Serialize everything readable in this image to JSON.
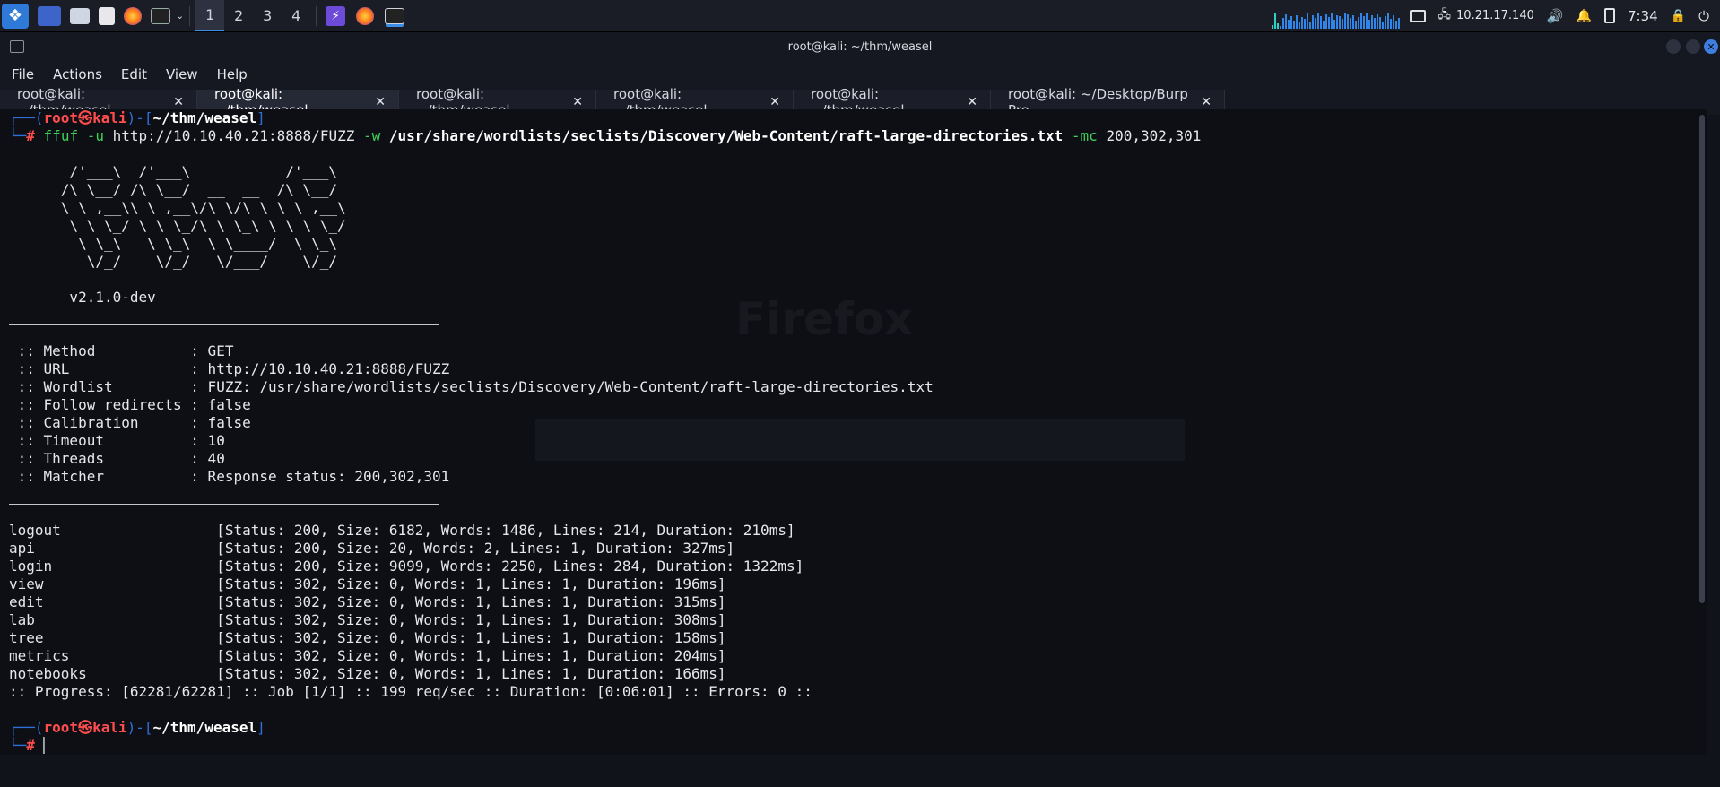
{
  "panel": {
    "workspaces": [
      "1",
      "2",
      "3",
      "4"
    ],
    "ip": "10.21.17.140",
    "clock": "7:34",
    "icons": [
      "kali-menu-icon",
      "desktop-icon",
      "files-icon",
      "text-editor-icon",
      "firefox-icon",
      "terminal-icon",
      "chevron-down-icon",
      "burp-icon",
      "firefox-icon",
      "terminal-icon",
      "display-icon",
      "network-icon",
      "volume-icon",
      "bell-icon",
      "battery-icon",
      "lock-icon",
      "power-icon"
    ],
    "accent": "#3a8ee6"
  },
  "window": {
    "title": "root@kali: ~/thm/weasel",
    "menu": [
      "File",
      "Actions",
      "Edit",
      "View",
      "Help"
    ],
    "tabs": [
      {
        "label": "root@kali: ~/thm/weasel",
        "active": false
      },
      {
        "label": "root@kali: ~/thm/weasel",
        "active": true
      },
      {
        "label": "root@kali: ~/thm/weasel",
        "active": false
      },
      {
        "label": "root@kali: ~/thm/weasel",
        "active": false
      },
      {
        "label": "root@kali: ~/thm/weasel",
        "active": false
      },
      {
        "label": "root@kali: ~/Desktop/Burp Pro",
        "active": false
      }
    ],
    "close_glyph": "✕"
  },
  "terminal": {
    "prompt1": {
      "frame_a": "┌──(",
      "user": "root",
      "skull": "㉿",
      "host": "kali",
      "frame_b": ")-[",
      "path": "~/thm/weasel",
      "frame_c": "]"
    },
    "cmd": {
      "frame": "└─",
      "hash": "#",
      "bin": "ffuf",
      "f1": "-u",
      "url": "http://10.10.40.21:8888/FUZZ",
      "f2": "-w",
      "wordlist": "/usr/share/wordlists/seclists/Discovery/Web-Content/raft-large-directories.txt",
      "f3": "-mc",
      "codes": "200,302,301"
    },
    "banner": [
      "       /'___\\  /'___\\           /'___\\       ",
      "      /\\ \\__/ /\\ \\__/  __  __  /\\ \\__/       ",
      "      \\ \\ ,__\\\\ \\ ,__\\/\\ \\/\\ \\ \\ \\ ,__\\      ",
      "       \\ \\ \\_/ \\ \\ \\_/\\ \\ \\_\\ \\ \\ \\ \\_/      ",
      "        \\ \\_\\   \\ \\_\\  \\ \\____/  \\ \\_\\       ",
      "         \\/_/    \\/_/   \\/___/    \\/_/       "
    ],
    "version": "       v2.1.0-dev",
    "config": [
      " :: Method           : GET",
      " :: URL              : http://10.10.40.21:8888/FUZZ",
      " :: Wordlist         : FUZZ: /usr/share/wordlists/seclists/Discovery/Web-Content/raft-large-directories.txt",
      " :: Follow redirects : false",
      " :: Calibration      : false",
      " :: Timeout          : 10",
      " :: Threads          : 40",
      " :: Matcher          : Response status: 200,302,301"
    ],
    "results": [
      "logout                  [Status: 200, Size: 6182, Words: 1486, Lines: 214, Duration: 210ms]",
      "api                     [Status: 200, Size: 20, Words: 2, Lines: 1, Duration: 327ms]",
      "login                   [Status: 200, Size: 9099, Words: 2250, Lines: 284, Duration: 1322ms]",
      "view                    [Status: 302, Size: 0, Words: 1, Lines: 1, Duration: 196ms]",
      "edit                    [Status: 302, Size: 0, Words: 1, Lines: 1, Duration: 315ms]",
      "lab                     [Status: 302, Size: 0, Words: 1, Lines: 1, Duration: 308ms]",
      "tree                    [Status: 302, Size: 0, Words: 1, Lines: 1, Duration: 158ms]",
      "metrics                 [Status: 302, Size: 0, Words: 1, Lines: 1, Duration: 204ms]",
      "notebooks               [Status: 302, Size: 0, Words: 1, Lines: 1, Duration: 166ms]"
    ],
    "progress": ":: Progress: [62281/62281] :: Job [1/1] :: 199 req/sec :: Duration: [0:06:01] :: Errors: 0 ::",
    "prompt2": {
      "frame_a": "┌──(",
      "user": "root",
      "skull": "㉿",
      "host": "kali",
      "frame_b": ")-[",
      "path": "~/thm/weasel",
      "frame_c": "]"
    },
    "prompt2_line2": {
      "frame": "└─",
      "hash": "#",
      "cursor": "▏"
    }
  },
  "background_ghost": {
    "firefox_text": "Firefox"
  }
}
